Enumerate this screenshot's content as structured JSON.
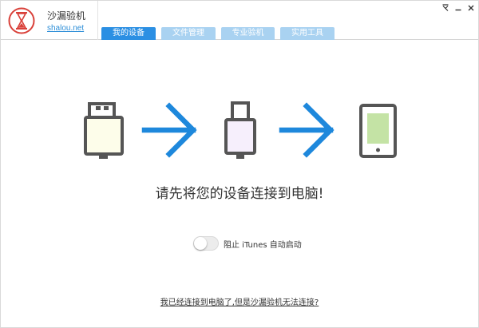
{
  "app": {
    "name": "沙漏验机",
    "site": "shalou.net"
  },
  "tabs": [
    {
      "label": "我的设备",
      "active": true
    },
    {
      "label": "文件管理",
      "active": false
    },
    {
      "label": "专业验机",
      "active": false
    },
    {
      "label": "实用工具",
      "active": false
    }
  ],
  "window_controls": {
    "restore_icon": "restore-icon",
    "minimize_icon": "minimize-icon",
    "close_icon": "close-icon"
  },
  "main": {
    "headline": "请先将您的设备连接到电脑!",
    "itunes_toggle": {
      "label": "阻止 iTunes 自动启动",
      "on": false
    },
    "help_link": "我已经连接到电脑了,但是沙漏验机无法连接?"
  },
  "colors": {
    "accent": "#2b8fe3",
    "tab_inactive": "#a9d2f1",
    "arrow": "#1e88dc",
    "usb_a_body": "#fdfdea",
    "lightning_body": "#f6effc",
    "phone_screen": "#c4e3a5",
    "logo_red": "#d9413a"
  }
}
